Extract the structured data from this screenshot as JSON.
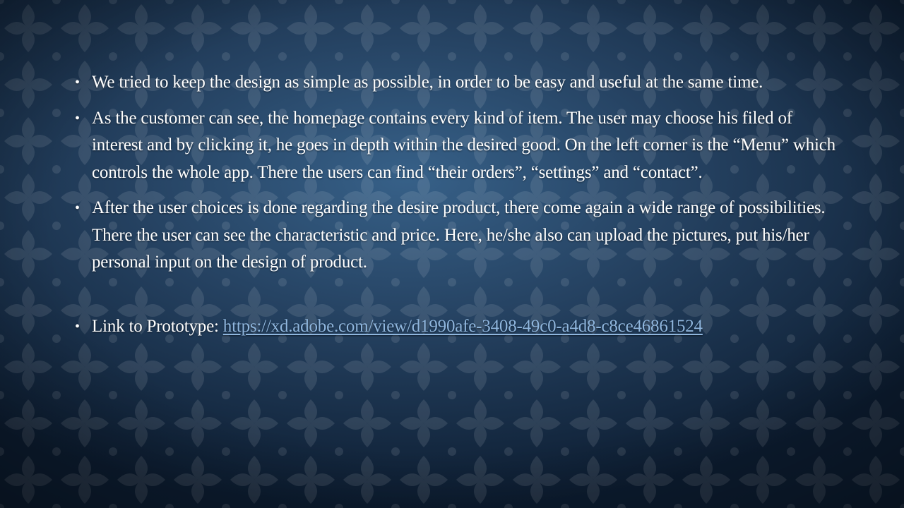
{
  "slide": {
    "bullets": [
      {
        "text": "We tried to keep the design as simple as possible, in order to be easy and useful at the same time."
      },
      {
        "text": "As the customer can see, the homepage contains every kind of item. The user may choose his filed of interest and by clicking it, he goes in depth within the desired good. On the left corner is the “Menu” which controls the whole app. There the users can find  “their orders”, “settings” and “contact”."
      },
      {
        "text": "After the user choices is done regarding the desire product, there come again a wide range of possibilities. There the user can see the characteristic and price. Here, he/she also can upload the pictures, put his/her personal input  on the design of product."
      }
    ],
    "link_bullet": {
      "label": "Link to Prototype: ",
      "url": "https://xd.adobe.com/view/d1990afe-3408-49c0-a4d8-c8ce46861524"
    },
    "bullet_glyph": "•",
    "colors": {
      "text": "#ffffff",
      "link": "#8fb6de",
      "background_center": "#2c5882",
      "background_edge": "#0c1c30"
    }
  }
}
